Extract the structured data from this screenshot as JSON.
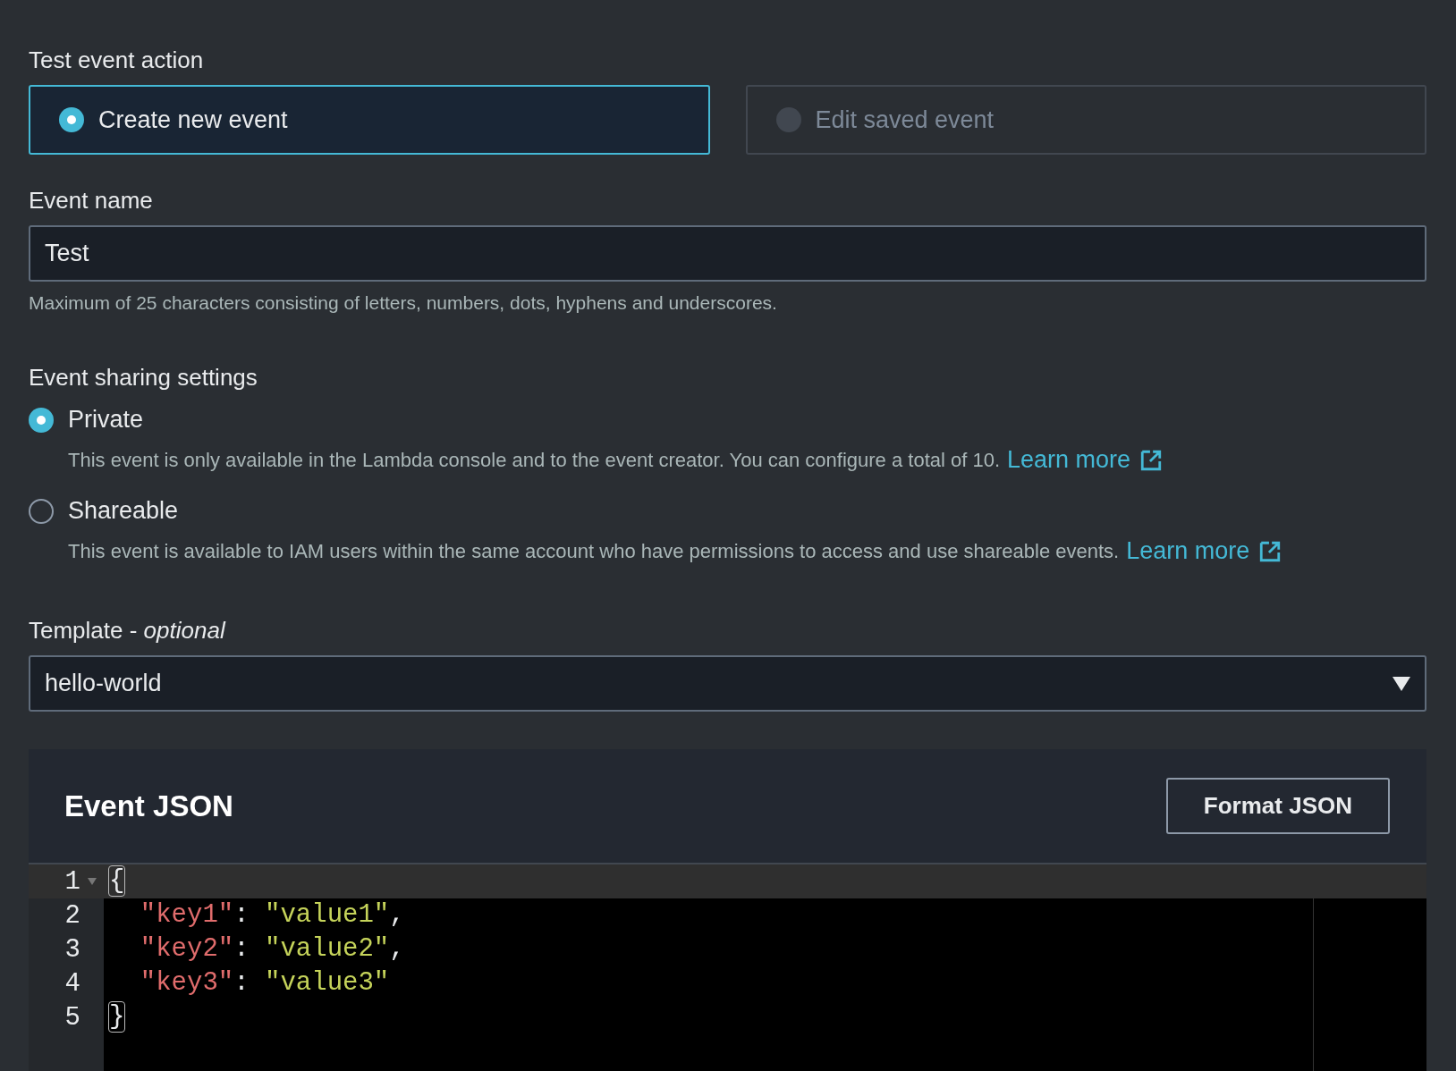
{
  "test_event_action": {
    "label": "Test event action",
    "options": [
      {
        "label": "Create new event",
        "selected": true,
        "disabled": false
      },
      {
        "label": "Edit saved event",
        "selected": false,
        "disabled": true
      }
    ]
  },
  "event_name": {
    "label": "Event name",
    "value": "Test",
    "hint": "Maximum of 25 characters consisting of letters, numbers, dots, hyphens and underscores."
  },
  "sharing": {
    "label": "Event sharing settings",
    "options": [
      {
        "label": "Private",
        "selected": true,
        "description": "This event is only available in the Lambda console and to the event creator. You can configure a total of 10.",
        "link": "Learn more"
      },
      {
        "label": "Shareable",
        "selected": false,
        "description": "This event is available to IAM users within the same account who have permissions to access and use shareable events.",
        "link": "Learn more"
      }
    ]
  },
  "template": {
    "label": "Template - *optional*",
    "value": "hello-world"
  },
  "editor": {
    "title": "Event JSON",
    "button": "Format JSON",
    "lines": [
      {
        "number": "1",
        "active": true,
        "foldable": true,
        "tokens": [
          {
            "kind": "bracket",
            "text": "{"
          }
        ]
      },
      {
        "number": "2",
        "active": false,
        "foldable": false,
        "tokens": [
          {
            "kind": "key",
            "text": "\"key1\""
          },
          {
            "kind": "punct",
            "text": ": "
          },
          {
            "kind": "string",
            "text": "\"value1\""
          },
          {
            "kind": "punct",
            "text": ","
          }
        ]
      },
      {
        "number": "3",
        "active": false,
        "foldable": false,
        "tokens": [
          {
            "kind": "key",
            "text": "\"key2\""
          },
          {
            "kind": "punct",
            "text": ": "
          },
          {
            "kind": "string",
            "text": "\"value2\""
          },
          {
            "kind": "punct",
            "text": ","
          }
        ]
      },
      {
        "number": "4",
        "active": false,
        "foldable": false,
        "tokens": [
          {
            "kind": "key",
            "text": "\"key3\""
          },
          {
            "kind": "punct",
            "text": ": "
          },
          {
            "kind": "string",
            "text": "\"value3\""
          }
        ]
      },
      {
        "number": "5",
        "active": false,
        "foldable": false,
        "tokens": [
          {
            "kind": "bracket",
            "text": "}"
          }
        ]
      }
    ]
  }
}
